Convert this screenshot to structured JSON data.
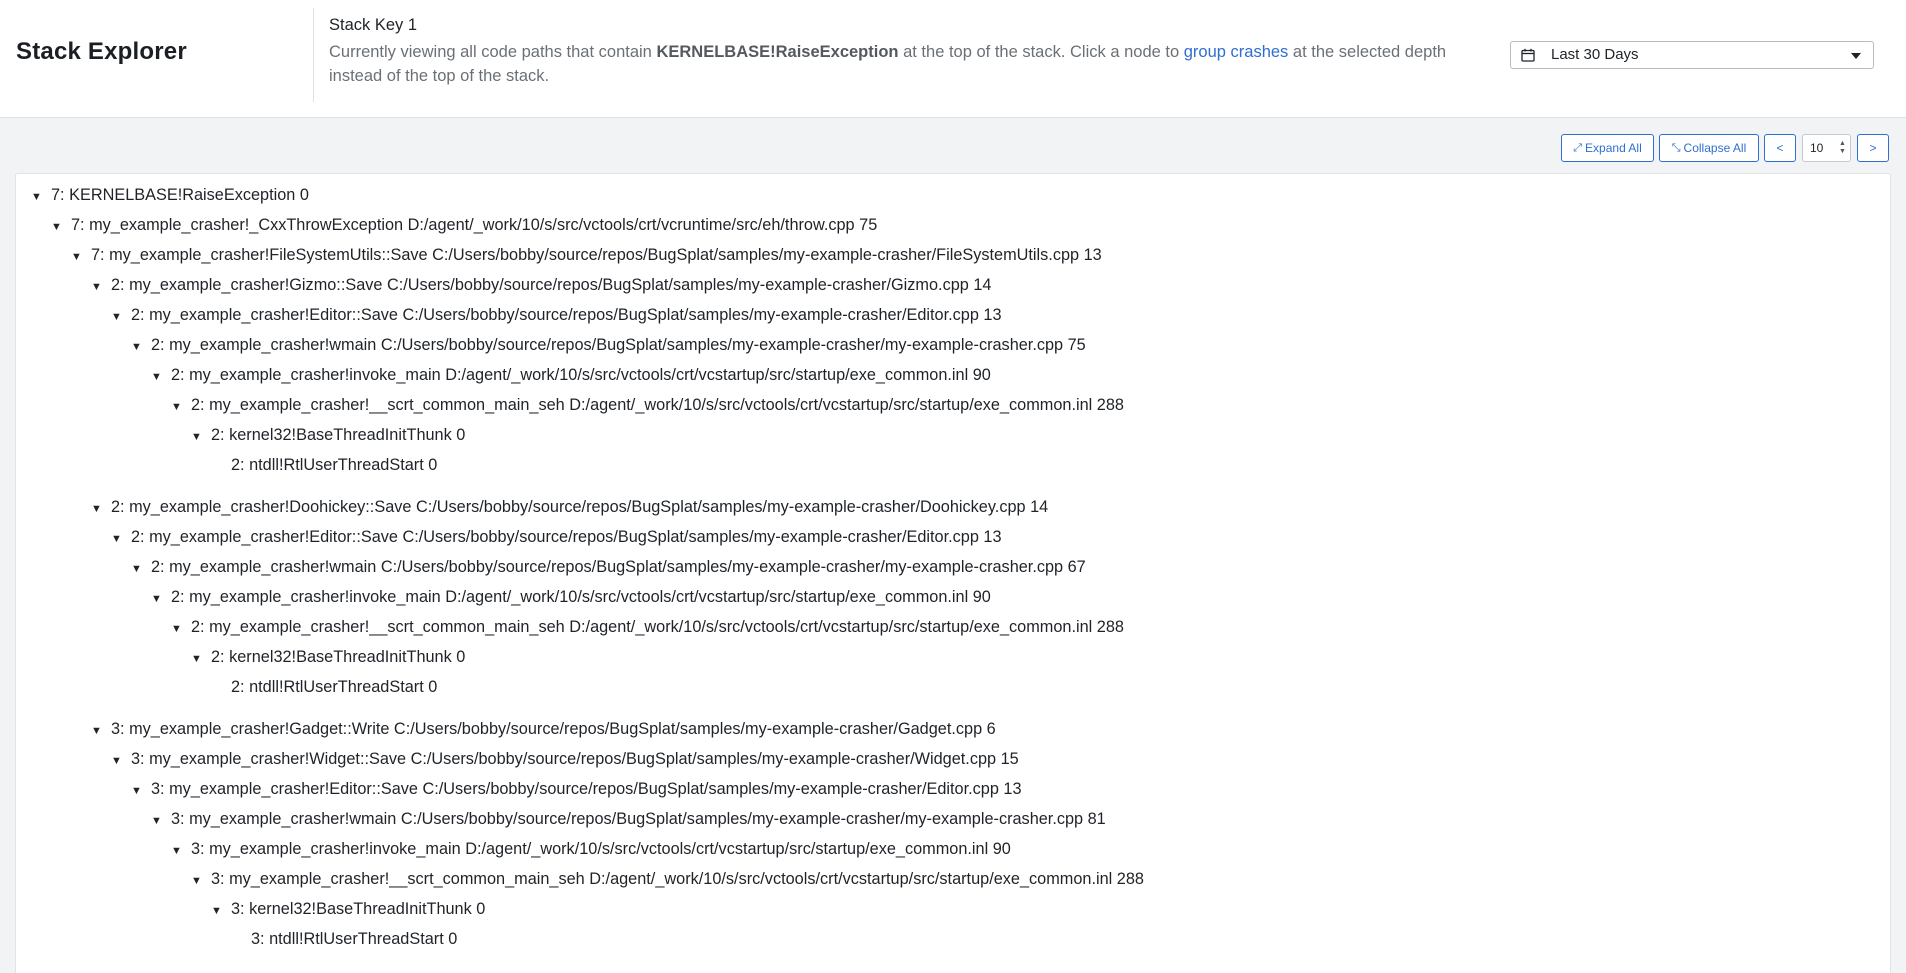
{
  "header": {
    "app_title": "Stack Explorer",
    "stack_key": "Stack Key 1",
    "desc_prefix": "Currently viewing all code paths that contain ",
    "desc_function": "KERNELBASE!RaiseException",
    "desc_middle": " at the top of the stack. Click a node to ",
    "desc_link": "group crashes",
    "desc_suffix": " at the selected depth instead of the top of the stack.",
    "date_range": "Last 30 Days"
  },
  "toolbar": {
    "expand_all": "Expand All",
    "collapse_all": "Collapse All",
    "prev": "<",
    "next": ">",
    "depth_value": "10"
  },
  "tree": {
    "toggle_glyph": "▼",
    "nodes": [
      {
        "label": "7: KERNELBASE!RaiseException 0"
      },
      {
        "label": "7: my_example_crasher!_CxxThrowException D:/agent/_work/10/s/src/vctools/crt/vcruntime/src/eh/throw.cpp 75"
      },
      {
        "label": "7: my_example_crasher!FileSystemUtils::Save C:/Users/bobby/source/repos/BugSplat/samples/my-example-crasher/FileSystemUtils.cpp 13"
      },
      {
        "label": "2: my_example_crasher!Gizmo::Save C:/Users/bobby/source/repos/BugSplat/samples/my-example-crasher/Gizmo.cpp 14"
      },
      {
        "label": "2: my_example_crasher!Editor::Save C:/Users/bobby/source/repos/BugSplat/samples/my-example-crasher/Editor.cpp 13"
      },
      {
        "label": "2: my_example_crasher!wmain C:/Users/bobby/source/repos/BugSplat/samples/my-example-crasher/my-example-crasher.cpp 75"
      },
      {
        "label": "2: my_example_crasher!invoke_main D:/agent/_work/10/s/src/vctools/crt/vcstartup/src/startup/exe_common.inl 90"
      },
      {
        "label": "2: my_example_crasher!__scrt_common_main_seh D:/agent/_work/10/s/src/vctools/crt/vcstartup/src/startup/exe_common.inl 288"
      },
      {
        "label": "2: kernel32!BaseThreadInitThunk 0"
      },
      {
        "label": "2: ntdll!RtlUserThreadStart 0"
      },
      {
        "label": "2: my_example_crasher!Doohickey::Save C:/Users/bobby/source/repos/BugSplat/samples/my-example-crasher/Doohickey.cpp 14"
      },
      {
        "label": "2: my_example_crasher!Editor::Save C:/Users/bobby/source/repos/BugSplat/samples/my-example-crasher/Editor.cpp 13"
      },
      {
        "label": "2: my_example_crasher!wmain C:/Users/bobby/source/repos/BugSplat/samples/my-example-crasher/my-example-crasher.cpp 67"
      },
      {
        "label": "2: my_example_crasher!invoke_main D:/agent/_work/10/s/src/vctools/crt/vcstartup/src/startup/exe_common.inl 90"
      },
      {
        "label": "2: my_example_crasher!__scrt_common_main_seh D:/agent/_work/10/s/src/vctools/crt/vcstartup/src/startup/exe_common.inl 288"
      },
      {
        "label": "2: kernel32!BaseThreadInitThunk 0"
      },
      {
        "label": "2: ntdll!RtlUserThreadStart 0"
      },
      {
        "label": "3: my_example_crasher!Gadget::Write C:/Users/bobby/source/repos/BugSplat/samples/my-example-crasher/Gadget.cpp 6"
      },
      {
        "label": "3: my_example_crasher!Widget::Save C:/Users/bobby/source/repos/BugSplat/samples/my-example-crasher/Widget.cpp 15"
      },
      {
        "label": "3: my_example_crasher!Editor::Save C:/Users/bobby/source/repos/BugSplat/samples/my-example-crasher/Editor.cpp 13"
      },
      {
        "label": "3: my_example_crasher!wmain C:/Users/bobby/source/repos/BugSplat/samples/my-example-crasher/my-example-crasher.cpp 81"
      },
      {
        "label": "3: my_example_crasher!invoke_main D:/agent/_work/10/s/src/vctools/crt/vcstartup/src/startup/exe_common.inl 90"
      },
      {
        "label": "3: my_example_crasher!__scrt_common_main_seh D:/agent/_work/10/s/src/vctools/crt/vcstartup/src/startup/exe_common.inl 288"
      },
      {
        "label": "3: kernel32!BaseThreadInitThunk 0"
      },
      {
        "label": "3: ntdll!RtlUserThreadStart 0"
      }
    ]
  }
}
